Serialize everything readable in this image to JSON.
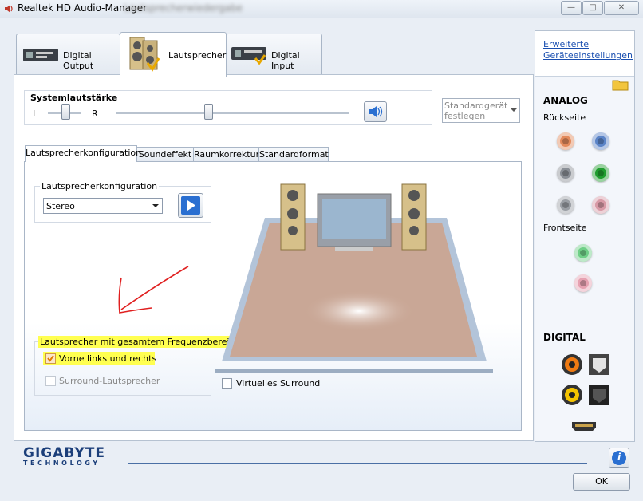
{
  "window": {
    "title": "Realtek HD Audio-Manager",
    "title_blurred": "Lautsprecherwiedergabe",
    "controls": {
      "minimize": "—",
      "maximize": "□",
      "close": "✕"
    }
  },
  "device_tabs": [
    {
      "label": "Digital Output",
      "active": false
    },
    {
      "label": "Lautsprecher",
      "active": true
    },
    {
      "label": "Digital Input",
      "active": false
    }
  ],
  "volume": {
    "label": "Systemlautstärke",
    "left": "L",
    "right": "R",
    "default_device_button": "Standardgerät festlegen"
  },
  "sub_tabs": [
    "Lautsprecherkonfiguration",
    "Soundeffekt",
    "Raumkorrektur",
    "Standardformat"
  ],
  "speaker_config": {
    "group_label": "Lautsprecherkonfiguration",
    "selected": "Stereo"
  },
  "fullrange": {
    "label": "Lautsprecher mit gesamtem Frequenzbereich",
    "front": "Vorne links und rechts",
    "surround": "Surround-Lautsprecher"
  },
  "virtual_surround": "Virtuelles Surround",
  "sidebar": {
    "advanced_link_line1": "Erweiterte",
    "advanced_link_line2": "Geräteeinstellungen",
    "analog": "ANALOG",
    "back": "Rückseite",
    "front": "Frontseite",
    "digital": "DIGITAL",
    "back_jack_colors": [
      "#e38a5c",
      "#5b84c7",
      "#8a8f96",
      "#1f9c2e",
      "#9a9ea4",
      "#d89aa6"
    ],
    "front_jack_colors": [
      "#6fcf87",
      "#e6a1b1"
    ]
  },
  "footer": {
    "brand": "GIGABYTE",
    "brand_sub": "TECHNOLOGY",
    "ok": "OK",
    "info": "i"
  }
}
